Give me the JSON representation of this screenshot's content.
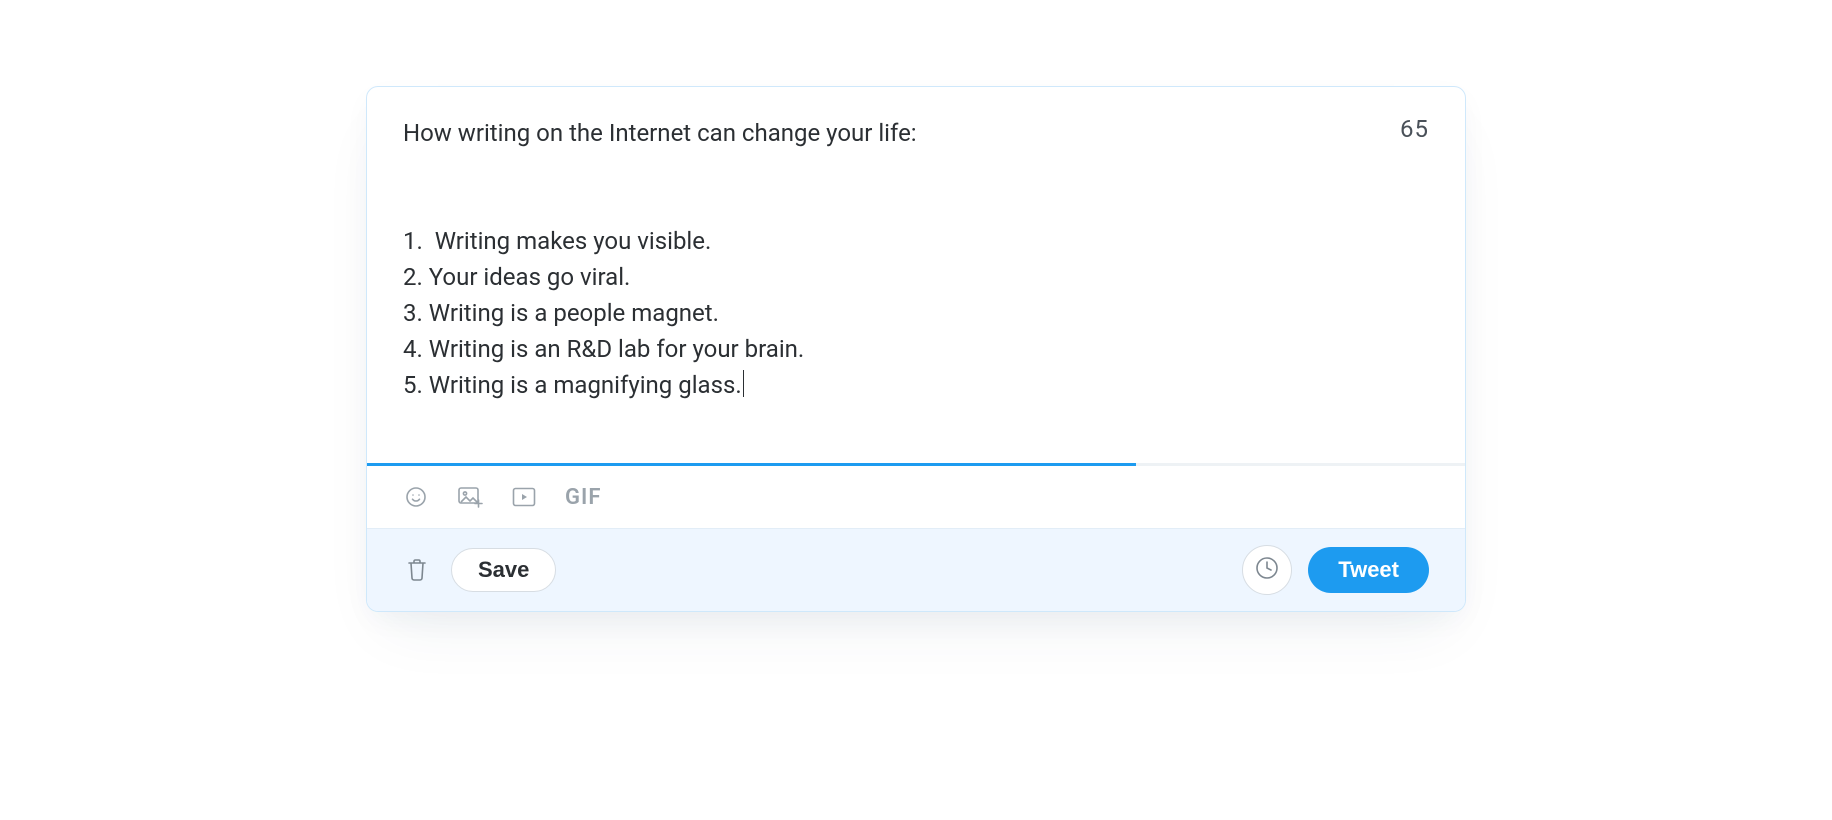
{
  "composer": {
    "title_line": "How writing on the Internet can change your life:",
    "list": [
      "1.  Writing makes you visible.",
      "2. Your ideas go viral.",
      "3. Writing is a people magnet.",
      "4. Writing is an R&D lab for your brain.",
      "5. Writing is a magnifying glass."
    ],
    "counter": "65",
    "progress_percent": 70
  },
  "media_bar": {
    "gif_label": "GIF",
    "icons": {
      "emoji": "emoji-icon",
      "image": "image-upload-icon",
      "video": "video-play-icon"
    }
  },
  "actions": {
    "save_label": "Save",
    "tweet_label": "Tweet"
  },
  "colors": {
    "accent": "#1d9bf0",
    "card_border": "#cfe8fb",
    "footer_bg": "#eef6ff",
    "muted_icon": "#9aa3ab"
  }
}
